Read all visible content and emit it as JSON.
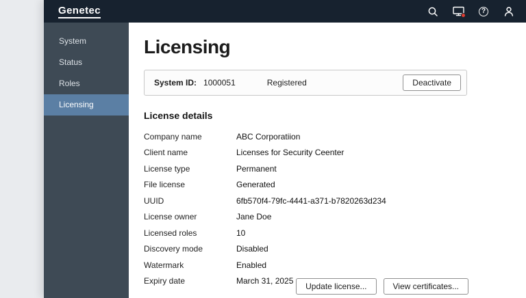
{
  "topbar": {
    "logo": "Genetec",
    "icons": {
      "help_glyph": "?"
    }
  },
  "sidebar": {
    "items": [
      {
        "label": "System",
        "selected": false
      },
      {
        "label": "Status",
        "selected": false
      },
      {
        "label": "Roles",
        "selected": false
      },
      {
        "label": "Licensing",
        "selected": true
      }
    ]
  },
  "main": {
    "title": "Licensing",
    "system_bar": {
      "label": "System ID:",
      "value": "1000051",
      "status": "Registered",
      "deactivate_label": "Deactivate"
    },
    "details": {
      "heading": "License details",
      "rows": [
        {
          "label": "Company name",
          "value": "ABC Corporatiion"
        },
        {
          "label": "Client name",
          "value": "Licenses for Security Ceenter"
        },
        {
          "label": "License type",
          "value": "Permanent"
        },
        {
          "label": "File license",
          "value": "Generated"
        },
        {
          "label": "UUID",
          "value": "6fb570f4-79fc-4441-a371-b7820263d234"
        },
        {
          "label": "License owner",
          "value": "Jane Doe"
        },
        {
          "label": "Licensed roles",
          "value": "10"
        },
        {
          "label": "Discovery mode",
          "value": "Disabled"
        },
        {
          "label": "Watermark",
          "value": "Enabled"
        },
        {
          "label": "Expiry date",
          "value": "March 31, 2025"
        }
      ]
    },
    "actions": {
      "update_label": "Update license...",
      "certificates_label": "View certificates..."
    }
  },
  "colors": {
    "topbar_navy": "#17222f",
    "sidebar_gray": "#3e4a55",
    "selected_blue": "#5b7fa4",
    "badge_red": "#e03c31",
    "page_background": "#e9ebee"
  }
}
